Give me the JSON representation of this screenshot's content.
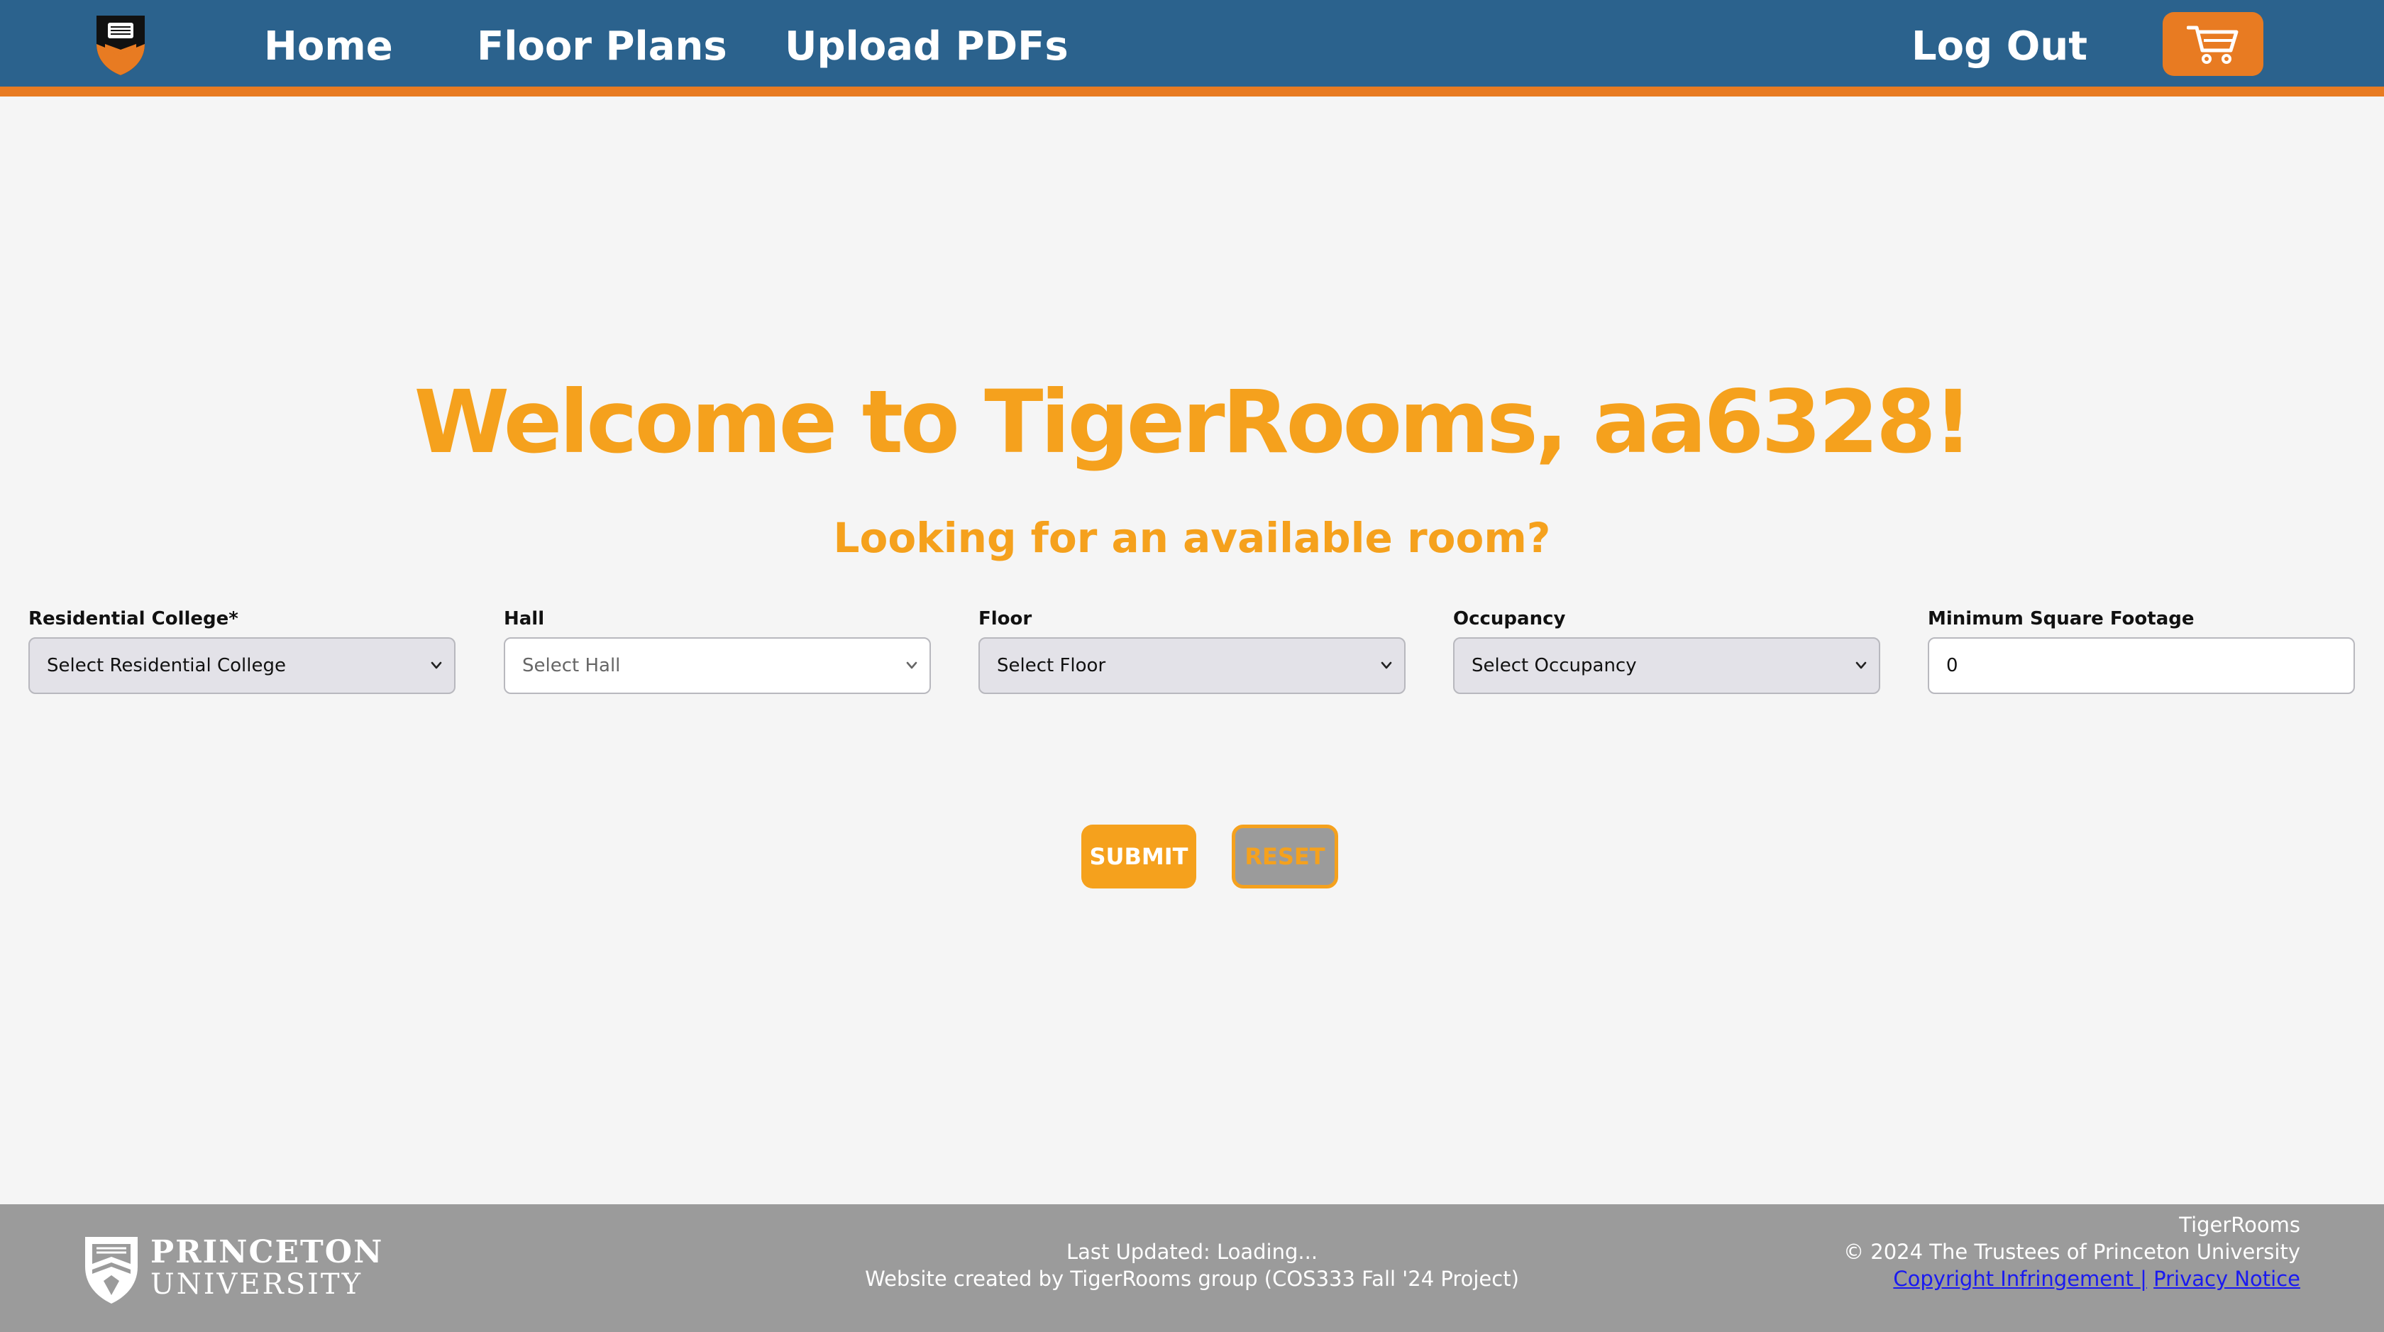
{
  "nav": {
    "logo_icon": "princeton-shield-icon",
    "home": "Home",
    "floor_plans": "Floor Plans",
    "upload_pdfs": "Upload PDFs",
    "log_out": "Log Out",
    "cart_icon": "shopping-cart-icon"
  },
  "main": {
    "welcome": "Welcome to TigerRooms, aa6328!",
    "subtitle": "Looking for an available room?"
  },
  "filters": [
    {
      "label": "Residential College*",
      "value": "Select Residential College"
    },
    {
      "label": "Hall",
      "value": "Select Hall"
    },
    {
      "label": "Floor",
      "value": "Select Floor"
    },
    {
      "label": "Occupancy",
      "value": "Select Occupancy"
    },
    {
      "label": "Minimum Square Footage",
      "value": "0"
    }
  ],
  "buttons": {
    "submit": "SUBMIT",
    "reset": "RESET"
  },
  "footer": {
    "logo_line1": "PRINCETON",
    "logo_line2": "UNIVERSITY",
    "last_updated": "Last Updated: Loading...",
    "created_by": "Website created by TigerRooms group (COS333 Fall '24 Project)",
    "site_name": "TigerRooms",
    "copyright": "© 2024 The Trustees of Princeton University",
    "copyright_link": "Copyright Infringement ",
    "separator": "|",
    "privacy_link": "Privacy Notice"
  },
  "colors": {
    "nav_bg": "#2b628d",
    "accent_orange": "#e87b22",
    "heading_orange": "#f5a11d",
    "footer_bg": "#9b9b9b",
    "page_bg": "#f5f5f5"
  }
}
